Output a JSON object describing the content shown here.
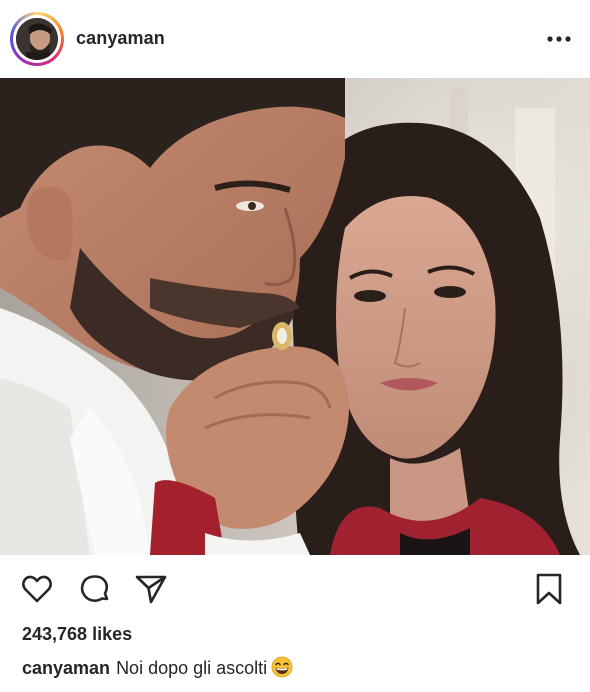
{
  "header": {
    "username": "canyaman",
    "avatar_icon": "profile-avatar",
    "more_icon": "more-options-icon"
  },
  "post": {
    "image_icon": "post-photo"
  },
  "actions": {
    "like_icon": "heart-icon",
    "comment_icon": "comment-icon",
    "share_icon": "send-icon",
    "save_icon": "bookmark-icon"
  },
  "likes": {
    "text": "243,768 likes"
  },
  "caption": {
    "username": "canyaman",
    "text": "Noi dopo gli ascolti",
    "emoji_icon": "grinning-face-emoji"
  },
  "colors": {
    "text": "#262626",
    "story_ring": [
      "#feda75",
      "#fa7e1e",
      "#d62976",
      "#962fbf",
      "#4f5bd5"
    ],
    "background": "#ffffff"
  }
}
